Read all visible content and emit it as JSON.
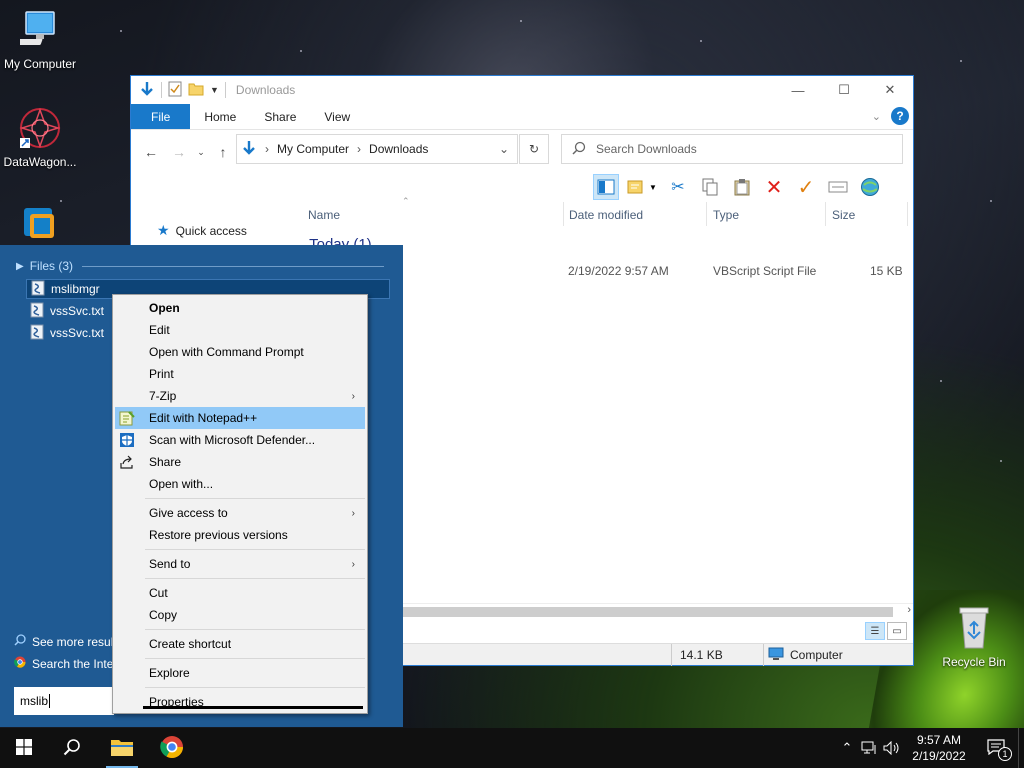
{
  "desktop": {
    "icons": [
      {
        "label": "My Computer"
      },
      {
        "label": "DataWagon..."
      },
      {
        "label": "Recycle Bin"
      }
    ]
  },
  "explorer": {
    "title": "Downloads",
    "tabs": [
      {
        "label": "File"
      },
      {
        "label": "Home"
      },
      {
        "label": "Share"
      },
      {
        "label": "View"
      }
    ],
    "breadcrumb": [
      "My Computer",
      "Downloads"
    ],
    "search_placeholder": "Search Downloads",
    "columns": [
      "Name",
      "Date modified",
      "Type",
      "Size"
    ],
    "nav_quick_access": "Quick access",
    "group_header": "Today (1)",
    "file": {
      "date": "2/19/2022 9:57 AM",
      "type": "VBScript Script File",
      "size": "15 KB"
    },
    "status": {
      "size": "14.1 KB",
      "location": "Computer"
    }
  },
  "start_search": {
    "section": "Files (3)",
    "results": [
      {
        "label": "mslibmgr"
      },
      {
        "label": "vssSvc.txt"
      },
      {
        "label": "vssSvc.txt"
      }
    ],
    "see_more": "See more result",
    "search_internet": "Search the Inte",
    "query": "mslib"
  },
  "context_menu": {
    "items": [
      {
        "label": "Open"
      },
      {
        "label": "Edit"
      },
      {
        "label": "Open with Command Prompt"
      },
      {
        "label": "Print"
      },
      {
        "label": "7-Zip"
      },
      {
        "label": "Edit with Notepad++"
      },
      {
        "label": "Scan with Microsoft Defender..."
      },
      {
        "label": "Share"
      },
      {
        "label": "Open with..."
      },
      {
        "label": "Give access to"
      },
      {
        "label": "Restore previous versions"
      },
      {
        "label": "Send to"
      },
      {
        "label": "Cut"
      },
      {
        "label": "Copy"
      },
      {
        "label": "Create shortcut"
      },
      {
        "label": "Explore"
      },
      {
        "label": "Properties"
      }
    ]
  },
  "taskbar": {
    "time": "9:57 AM",
    "date": "2/19/2022",
    "notification_count": "1"
  },
  "colors": {
    "accent": "#1979ca",
    "start_panel": "#1f5a93",
    "menu_highlight": "#91c9f7"
  }
}
